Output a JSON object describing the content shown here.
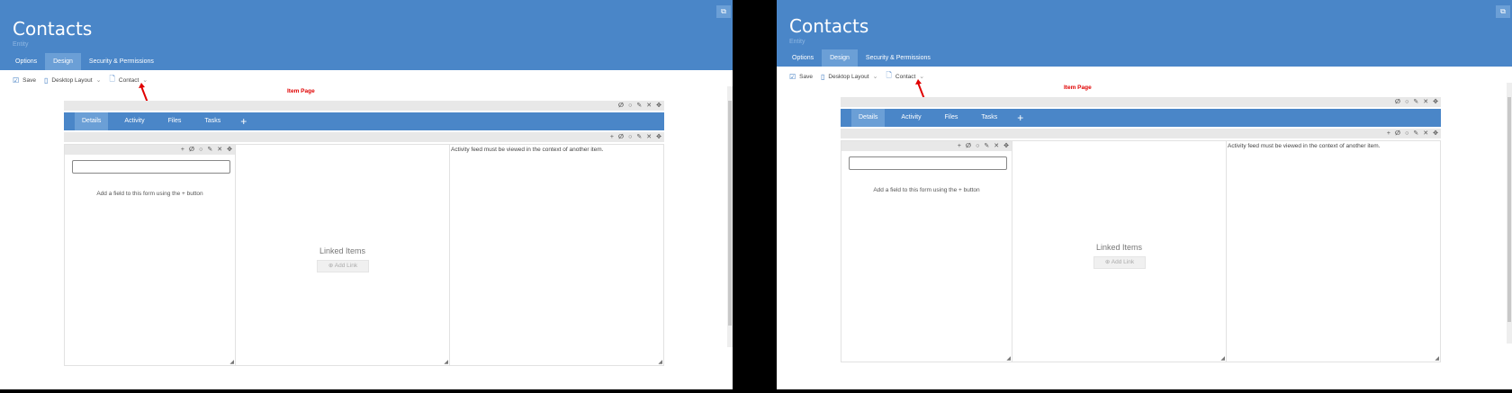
{
  "app": {
    "title": "Contacts",
    "subtitle": "Entity",
    "corner_icon": "edit-window-icon"
  },
  "tabs": [
    {
      "label": "Options",
      "active": false
    },
    {
      "label": "Design",
      "active": true
    },
    {
      "label": "Security & Permissions",
      "active": false
    }
  ],
  "toolbar": {
    "save_label": "Save",
    "layout_label": "Desktop Layout",
    "page_label": "Contact"
  },
  "annotation": {
    "label": "Item Page",
    "color": "#e00000"
  },
  "designer": {
    "tabs": [
      {
        "label": "Details",
        "active": true
      },
      {
        "label": "Activity",
        "active": false
      },
      {
        "label": "Files",
        "active": false
      },
      {
        "label": "Tasks",
        "active": false
      }
    ],
    "add_tab_icon": "plus-icon",
    "add_field_hint": "Add a field to this form using the + button",
    "linked_items_title": "Linked Items",
    "add_link_label": "Add Link",
    "activity_message": "Activity feed must be viewed in the context of another item."
  },
  "icons": {
    "row_controls": [
      "eye-off-icon",
      "circle-icon",
      "pencil-icon",
      "close-icon",
      "move-icon"
    ],
    "section_controls": [
      "plus-icon",
      "eye-off-icon",
      "circle-icon",
      "pencil-icon",
      "close-icon",
      "move-icon"
    ]
  },
  "colors": {
    "header": "#4a86c8",
    "active_tab": "#6b9fd6",
    "control_bar": "#e8e8e8"
  }
}
